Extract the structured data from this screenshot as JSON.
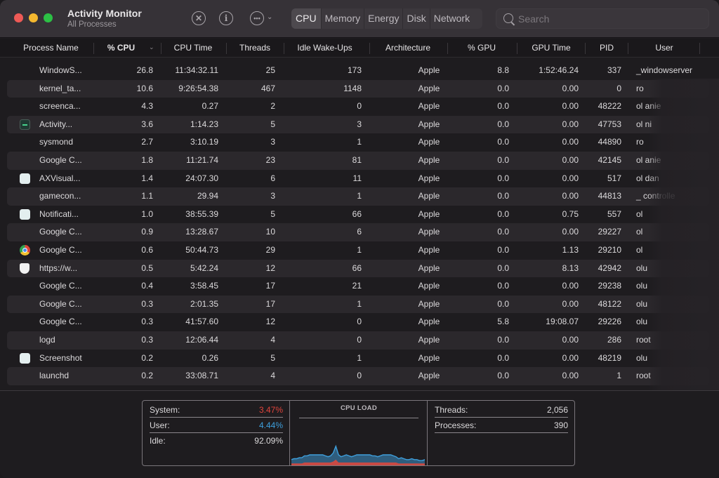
{
  "window": {
    "title": "Activity Monitor",
    "subtitle": "All Processes"
  },
  "toolbar": {
    "stop_icon": "stop-process-icon",
    "info_icon": "info-icon",
    "more_icon": "ellipsis-icon",
    "tabs": [
      "CPU",
      "Memory",
      "Energy",
      "Disk",
      "Network"
    ],
    "active_tab": "CPU",
    "search_placeholder": "Search",
    "search_value": ""
  },
  "columns": [
    "Process Name",
    "% CPU",
    "CPU Time",
    "Threads",
    "Idle Wake-Ups",
    "Architecture",
    "% GPU",
    "GPU Time",
    "PID",
    "User"
  ],
  "sort_column": "% CPU",
  "processes": [
    {
      "icon": "none",
      "name": "WindowS...",
      "cpu": "26.8",
      "cpu_time": "11:34:32.11",
      "threads": "25",
      "idle_wakeups": "173",
      "arch": "Apple",
      "gpu": "8.8",
      "gpu_time": "1:52:46.24",
      "pid": "337",
      "user": "_windowserver"
    },
    {
      "icon": "none",
      "name": "kernel_ta...",
      "cpu": "10.6",
      "cpu_time": "9:26:54.38",
      "threads": "467",
      "idle_wakeups": "1148",
      "arch": "Apple",
      "gpu": "0.0",
      "gpu_time": "0.00",
      "pid": "0",
      "user": "ro"
    },
    {
      "icon": "none",
      "name": "screenca...",
      "cpu": "4.3",
      "cpu_time": "0.27",
      "threads": "2",
      "idle_wakeups": "0",
      "arch": "Apple",
      "gpu": "0.0",
      "gpu_time": "0.00",
      "pid": "48222",
      "user": "ol      anie"
    },
    {
      "icon": "activity",
      "name": "Activity...",
      "cpu": "3.6",
      "cpu_time": "1:14.23",
      "threads": "5",
      "idle_wakeups": "3",
      "arch": "Apple",
      "gpu": "0.0",
      "gpu_time": "0.00",
      "pid": "47753",
      "user": "ol       ni"
    },
    {
      "icon": "none",
      "name": "sysmond",
      "cpu": "2.7",
      "cpu_time": "3:10.19",
      "threads": "3",
      "idle_wakeups": "1",
      "arch": "Apple",
      "gpu": "0.0",
      "gpu_time": "0.00",
      "pid": "44890",
      "user": "ro"
    },
    {
      "icon": "none",
      "name": "Google C...",
      "cpu": "1.8",
      "cpu_time": "11:21.74",
      "threads": "23",
      "idle_wakeups": "81",
      "arch": "Apple",
      "gpu": "0.0",
      "gpu_time": "0.00",
      "pid": "42145",
      "user": "ol      anie"
    },
    {
      "icon": "generic",
      "name": "AXVisual...",
      "cpu": "1.4",
      "cpu_time": "24:07.30",
      "threads": "6",
      "idle_wakeups": "11",
      "arch": "Apple",
      "gpu": "0.0",
      "gpu_time": "0.00",
      "pid": "517",
      "user": "ol     dan"
    },
    {
      "icon": "none",
      "name": "gamecon...",
      "cpu": "1.1",
      "cpu_time": "29.94",
      "threads": "3",
      "idle_wakeups": "1",
      "arch": "Apple",
      "gpu": "0.0",
      "gpu_time": "0.00",
      "pid": "44813",
      "user": "_    controlle"
    },
    {
      "icon": "generic",
      "name": "Notificati...",
      "cpu": "1.0",
      "cpu_time": "38:55.39",
      "threads": "5",
      "idle_wakeups": "66",
      "arch": "Apple",
      "gpu": "0.0",
      "gpu_time": "0.75",
      "pid": "557",
      "user": "ol"
    },
    {
      "icon": "none",
      "name": "Google C...",
      "cpu": "0.9",
      "cpu_time": "13:28.67",
      "threads": "10",
      "idle_wakeups": "6",
      "arch": "Apple",
      "gpu": "0.0",
      "gpu_time": "0.00",
      "pid": "29227",
      "user": "ol"
    },
    {
      "icon": "chrome",
      "name": "Google C...",
      "cpu": "0.6",
      "cpu_time": "50:44.73",
      "threads": "29",
      "idle_wakeups": "1",
      "arch": "Apple",
      "gpu": "0.0",
      "gpu_time": "1.13",
      "pid": "29210",
      "user": "ol"
    },
    {
      "icon": "shield",
      "name": "https://w...",
      "cpu": "0.5",
      "cpu_time": "5:42.24",
      "threads": "12",
      "idle_wakeups": "66",
      "arch": "Apple",
      "gpu": "0.0",
      "gpu_time": "8.13",
      "pid": "42942",
      "user": "olu"
    },
    {
      "icon": "none",
      "name": "Google C...",
      "cpu": "0.4",
      "cpu_time": "3:58.45",
      "threads": "17",
      "idle_wakeups": "21",
      "arch": "Apple",
      "gpu": "0.0",
      "gpu_time": "0.00",
      "pid": "29238",
      "user": "olu"
    },
    {
      "icon": "none",
      "name": "Google C...",
      "cpu": "0.3",
      "cpu_time": "2:01.35",
      "threads": "17",
      "idle_wakeups": "1",
      "arch": "Apple",
      "gpu": "0.0",
      "gpu_time": "0.00",
      "pid": "48122",
      "user": "olu"
    },
    {
      "icon": "none",
      "name": "Google C...",
      "cpu": "0.3",
      "cpu_time": "41:57.60",
      "threads": "12",
      "idle_wakeups": "0",
      "arch": "Apple",
      "gpu": "5.8",
      "gpu_time": "19:08.07",
      "pid": "29226",
      "user": "olu"
    },
    {
      "icon": "none",
      "name": "logd",
      "cpu": "0.3",
      "cpu_time": "12:06.44",
      "threads": "4",
      "idle_wakeups": "0",
      "arch": "Apple",
      "gpu": "0.0",
      "gpu_time": "0.00",
      "pid": "286",
      "user": "root"
    },
    {
      "icon": "generic",
      "name": "Screenshot",
      "cpu": "0.2",
      "cpu_time": "0.26",
      "threads": "5",
      "idle_wakeups": "1",
      "arch": "Apple",
      "gpu": "0.0",
      "gpu_time": "0.00",
      "pid": "48219",
      "user": "olu"
    },
    {
      "icon": "none",
      "name": "launchd",
      "cpu": "0.2",
      "cpu_time": "33:08.71",
      "threads": "4",
      "idle_wakeups": "0",
      "arch": "Apple",
      "gpu": "0.0",
      "gpu_time": "0.00",
      "pid": "1",
      "user": "root"
    }
  ],
  "summary": {
    "system_label": "System:",
    "system_value": "3.47%",
    "user_label": "User:",
    "user_value": "4.44%",
    "idle_label": "Idle:",
    "idle_value": "92.09%",
    "cpu_load_title": "CPU LOAD",
    "threads_label": "Threads:",
    "threads_value": "2,056",
    "processes_label": "Processes:",
    "processes_value": "390"
  },
  "colors": {
    "system": "#e0443c",
    "user": "#3e9fdc",
    "close": "#ee5a56",
    "minimize": "#f4b82f",
    "maximize": "#2cc045"
  },
  "cpu_load_history": {
    "user_pct": [
      4,
      5,
      5,
      6,
      6,
      7,
      7,
      8,
      8,
      8,
      8,
      8,
      8,
      7,
      6,
      7,
      9,
      14,
      8,
      6,
      7,
      8,
      7,
      6,
      7,
      8,
      8,
      8,
      8,
      8,
      8,
      7,
      7,
      6,
      7,
      8,
      8,
      8,
      8,
      7,
      6,
      5,
      6,
      5,
      4,
      4,
      5,
      4,
      4,
      3,
      3,
      4
    ],
    "system_pct": [
      2,
      2,
      2,
      2,
      2,
      3,
      3,
      3,
      3,
      3,
      3,
      3,
      3,
      3,
      3,
      3,
      4,
      6,
      3,
      3,
      3,
      3,
      3,
      3,
      3,
      3,
      3,
      3,
      3,
      3,
      3,
      3,
      3,
      3,
      3,
      3,
      3,
      3,
      3,
      3,
      3,
      2,
      2,
      2,
      2,
      2,
      2,
      2,
      2,
      2,
      2,
      2
    ]
  }
}
